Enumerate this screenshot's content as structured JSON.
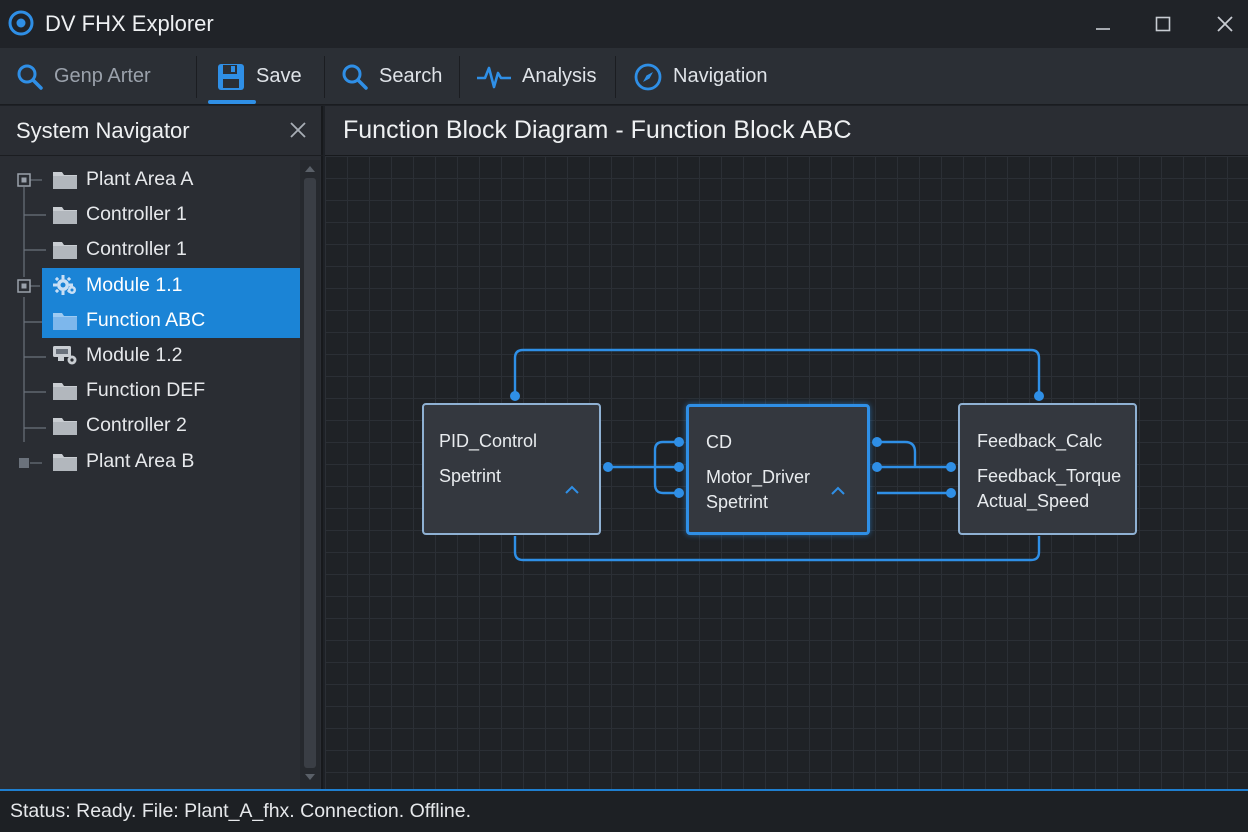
{
  "window": {
    "title": "DV FHX Explorer",
    "controls": {
      "minimize": "minimize-icon",
      "maximize": "maximize-icon",
      "close": "close-icon"
    }
  },
  "toolbar": {
    "items": [
      {
        "label": "Genp Arter",
        "icon": "search-icon",
        "disabled": true
      },
      {
        "label": "Save",
        "icon": "save-icon",
        "active": true
      },
      {
        "label": "Search",
        "icon": "search-icon"
      },
      {
        "label": "Analysis",
        "icon": "pulse-icon"
      },
      {
        "label": "Navigation",
        "icon": "compass-icon"
      }
    ]
  },
  "navigator": {
    "title": "System Navigator",
    "items": [
      {
        "label": "Plant Area A",
        "icon": "folder-icon",
        "expander": true
      },
      {
        "label": "Controller 1",
        "icon": "folder-icon"
      },
      {
        "label": "Controller 1",
        "icon": "folder-icon"
      },
      {
        "label": "Module 1.1",
        "icon": "gear-icon",
        "expander": true,
        "selected": true
      },
      {
        "label": "Function ABC",
        "icon": "folder-icon",
        "selected": true
      },
      {
        "label": "Module 1.2",
        "icon": "module-icon"
      },
      {
        "label": "Function DEF",
        "icon": "folder-icon"
      },
      {
        "label": "Controller 2",
        "icon": "folder-icon"
      },
      {
        "label": "Plant Area B",
        "icon": "folder-icon",
        "expander": true
      }
    ]
  },
  "diagram": {
    "title": "Function Block Diagram - Function Block ABC",
    "blocks": [
      {
        "id": "pid",
        "lines": [
          "PID_Control",
          "Spetrint"
        ]
      },
      {
        "id": "motor",
        "lines": [
          "CD",
          "Motor_Driver",
          "Spetrint"
        ]
      },
      {
        "id": "feedback",
        "lines": [
          "Feedback_Calc",
          "Feedback_Torque",
          "Actual_Speed"
        ]
      }
    ],
    "colors": {
      "wire": "#2f8fe6",
      "block_border": "#8fb1d3",
      "accent": "#1b84d6"
    }
  },
  "status": {
    "text": "Status: Ready. File: Plant_A_fhx. Connection. Offline."
  }
}
